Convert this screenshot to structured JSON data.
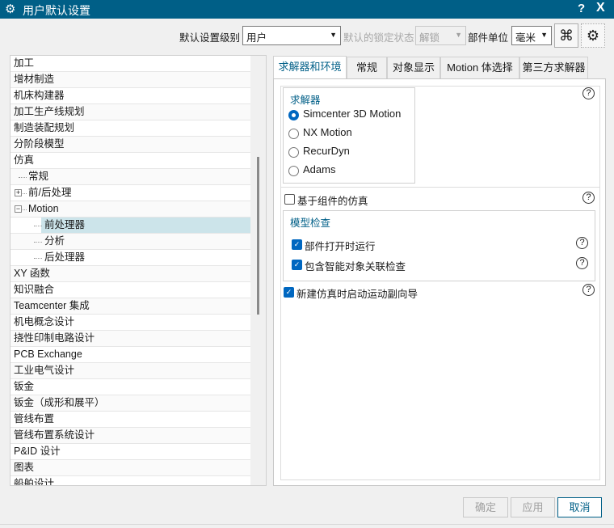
{
  "window": {
    "title": "用户默认设置",
    "help": "?",
    "close": "X"
  },
  "toolbar": {
    "level_label": "默认设置级别",
    "level_value": "用户",
    "lock_label": "默认的锁定状态",
    "lock_value": "解锁",
    "unit_label": "部件单位",
    "unit_value": "毫米"
  },
  "tree": [
    {
      "label": "加工",
      "level": 0
    },
    {
      "label": "增材制造",
      "level": 0
    },
    {
      "label": "机床构建器",
      "level": 0
    },
    {
      "label": "加工生产线规划",
      "level": 0
    },
    {
      "label": "制造装配规划",
      "level": 0
    },
    {
      "label": "分阶段模型",
      "level": 0
    },
    {
      "label": "仿真",
      "level": 0
    },
    {
      "label": "常规",
      "level": 1
    },
    {
      "label": "前/后处理",
      "level": 1,
      "expander": "+"
    },
    {
      "label": "Motion",
      "level": 1,
      "expander": "−"
    },
    {
      "label": "前处理器",
      "level": 2,
      "selected": true
    },
    {
      "label": "分析",
      "level": 2
    },
    {
      "label": "后处理器",
      "level": 2
    },
    {
      "label": "XY 函数",
      "level": 0
    },
    {
      "label": "知识融合",
      "level": 0
    },
    {
      "label": "Teamcenter 集成",
      "level": 0
    },
    {
      "label": "机电概念设计",
      "level": 0
    },
    {
      "label": "挠性印制电路设计",
      "level": 0
    },
    {
      "label": "PCB Exchange",
      "level": 0
    },
    {
      "label": "工业电气设计",
      "level": 0
    },
    {
      "label": "钣金",
      "level": 0
    },
    {
      "label": "钣金（成形和展平）",
      "level": 0
    },
    {
      "label": "管线布置",
      "level": 0
    },
    {
      "label": "管线布置系统设计",
      "level": 0
    },
    {
      "label": "P&ID 设计",
      "level": 0
    },
    {
      "label": "图表",
      "level": 0
    },
    {
      "label": "船舶设计",
      "level": 0
    }
  ],
  "tabs": [
    "求解器和环境",
    "常规",
    "对象显示",
    "Motion 体选择",
    "第三方求解器"
  ],
  "solver": {
    "title": "求解器",
    "options": [
      "Simcenter 3D Motion",
      "NX Motion",
      "RecurDyn",
      "Adams"
    ],
    "selected": 0
  },
  "component_sim": {
    "label": "基于组件的仿真",
    "checked": false
  },
  "model_check": {
    "title": "模型检查",
    "items": [
      {
        "label": "部件打开时运行",
        "checked": true
      },
      {
        "label": "包含智能对象关联检查",
        "checked": true
      }
    ]
  },
  "wizard": {
    "label": "新建仿真时启动运动副向导",
    "checked": true
  },
  "buttons": {
    "ok": "确定",
    "apply": "应用",
    "cancel": "取消"
  },
  "colors": {
    "titlebar": "#005f87",
    "accent": "#0067c0",
    "selection": "#cce4ea"
  }
}
